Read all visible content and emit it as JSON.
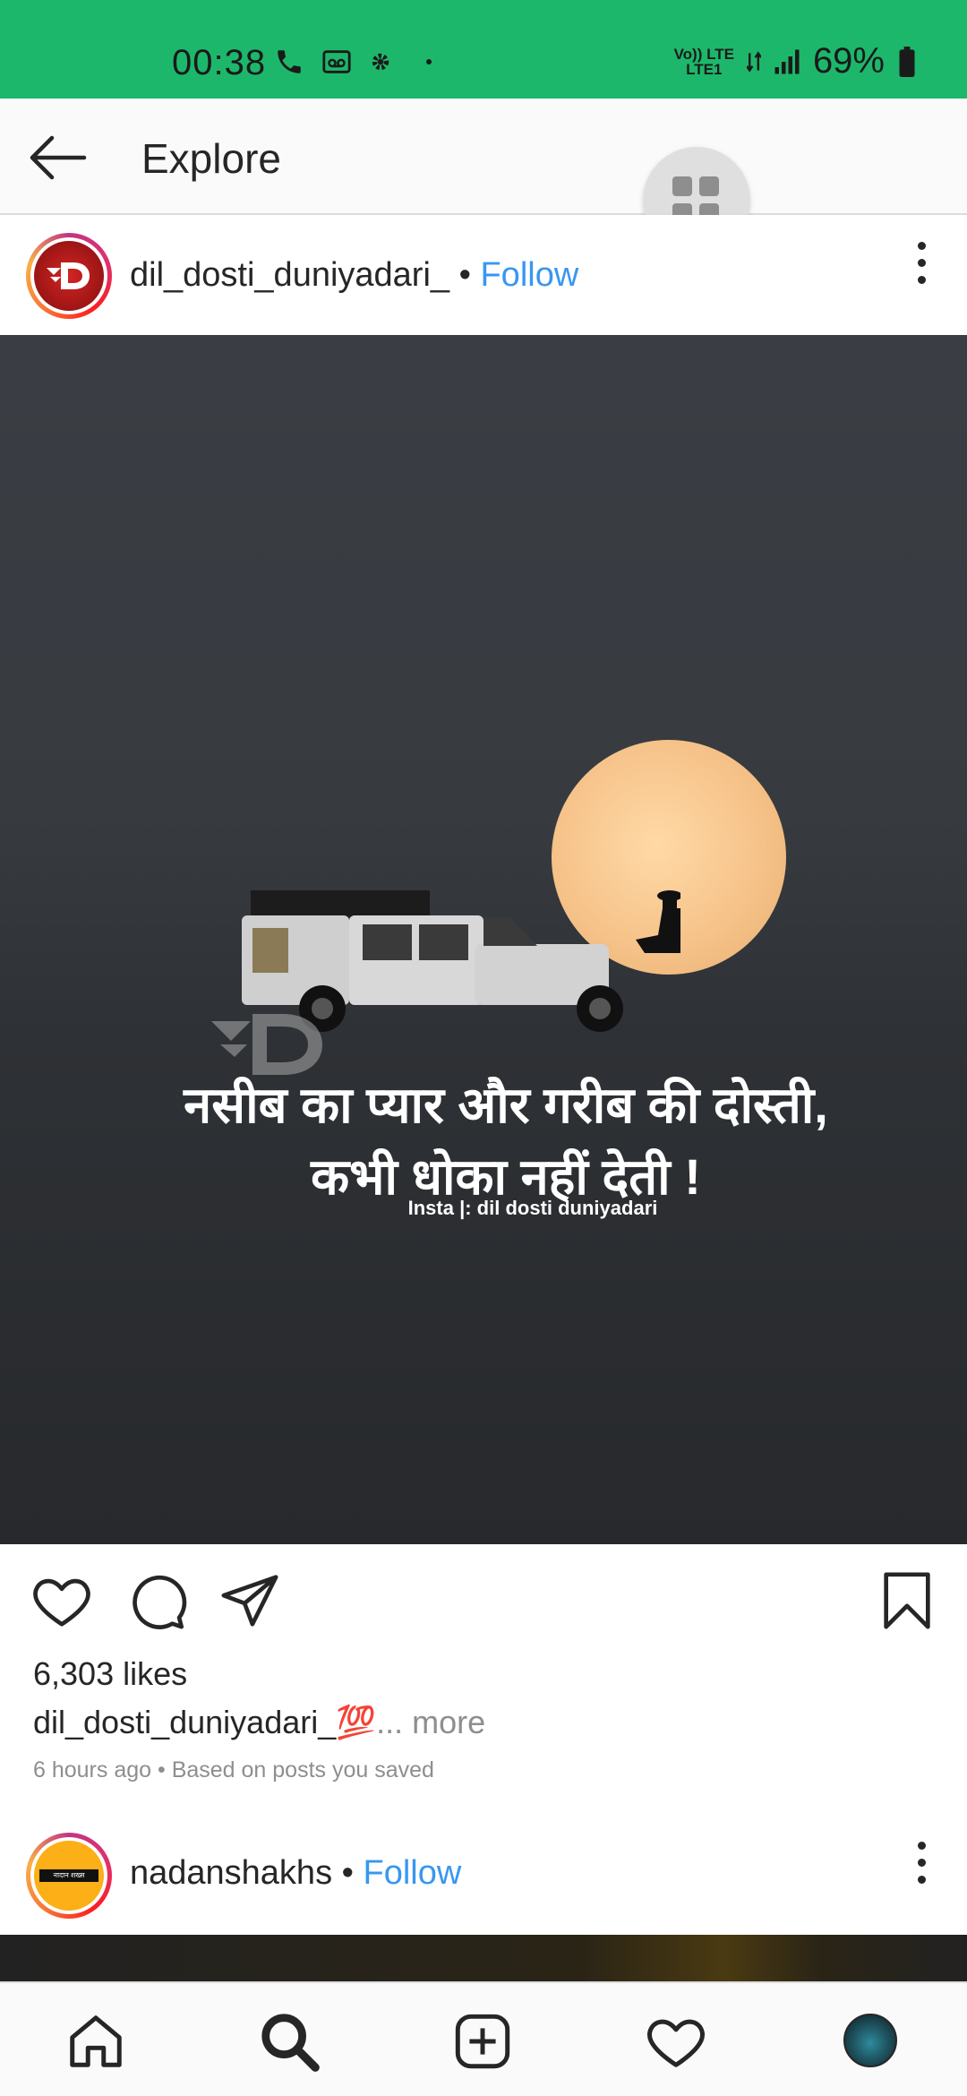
{
  "status_bar": {
    "time": "00:38",
    "network_top": "Vo)) LTE",
    "network_bottom": "LTE1",
    "battery": "69%"
  },
  "header": {
    "title": "Explore"
  },
  "post": {
    "username": "dil_dosti_duniyadari_",
    "separator": "•",
    "follow_label": "Follow",
    "image_text_line1": "नसीब का प्यार और गरीब की दोस्ती,",
    "image_text_line2": "कभी धोका नहीं देती !",
    "image_credit": "Insta |: dil dosti duniyadari",
    "likes": "6,303 likes",
    "caption_user": "dil_dosti_duniyadari_",
    "caption_emoji": "💯",
    "caption_more": "... more",
    "meta": "6 hours ago • Based on posts you saved"
  },
  "next_post": {
    "username": "nadanshakhs",
    "separator": "•",
    "follow_label": "Follow",
    "avatar_text": "नादान शख्स"
  },
  "colors": {
    "status_bar": "#1db76b",
    "follow": "#3897f0",
    "text": "#262626",
    "muted": "#8e8e8e"
  },
  "icons": {
    "back": "arrow-left-icon",
    "grid": "grid-icon",
    "more": "more-vertical-icon",
    "like": "heart-icon",
    "comment": "comment-icon",
    "share": "send-icon",
    "save": "bookmark-icon",
    "home": "home-icon",
    "search": "search-icon",
    "add": "add-post-icon",
    "activity": "heart-icon",
    "profile": "profile-avatar"
  }
}
